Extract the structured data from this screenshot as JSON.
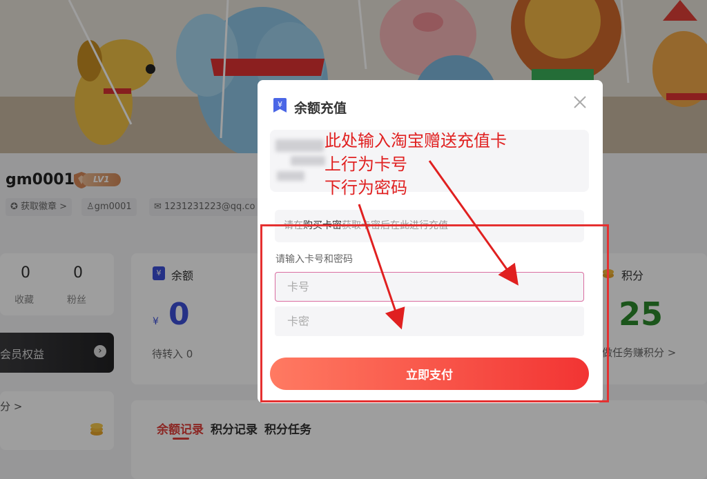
{
  "user": {
    "name": "gm0001",
    "level": "LV1",
    "chips": [
      "获取徽章 >",
      "gm0001",
      "1231231223@qq.co"
    ]
  },
  "stats": {
    "favorites": {
      "value": "0",
      "label": "收藏"
    },
    "fans": {
      "value": "0",
      "label": "粉丝"
    }
  },
  "vip": {
    "label": "会员权益"
  },
  "side_link": "分 >",
  "balance": {
    "title": "余额",
    "currency": "¥",
    "value": "0",
    "pending": "待转入 0"
  },
  "points": {
    "title": "积分",
    "value": "25",
    "link": "做任务赚积分 >"
  },
  "tabs": [
    "余额记录",
    "积分记录",
    "积分任务"
  ],
  "modal": {
    "title": "余额充值",
    "hint_prefix": "请在",
    "hint_link": "购买卡密",
    "hint_suffix": "获取卡密后在此进行充值",
    "form_label": "请输入卡号和密码",
    "card_placeholder": "卡号",
    "password_placeholder": "卡密",
    "pay_label": "立即支付"
  },
  "annotation": {
    "lines": [
      "此处输入淘宝赠送充值卡",
      "上行为卡号",
      "下行为密码"
    ],
    "color": "#e02020"
  },
  "colors": {
    "accent": "#e0403a",
    "balance": "#3d4fd8",
    "points": "#2c8a2c"
  }
}
